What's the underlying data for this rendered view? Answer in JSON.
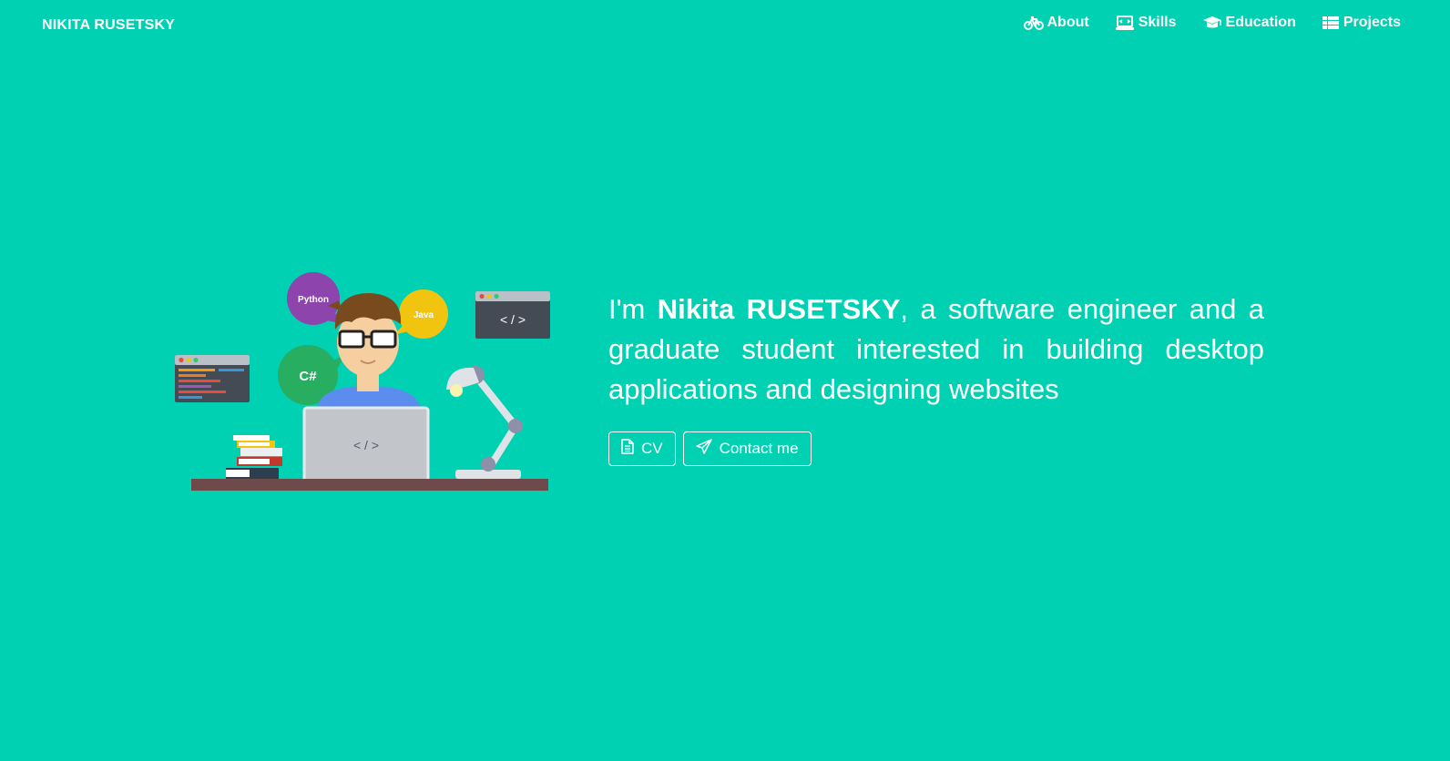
{
  "navbar": {
    "brand": "NIKITA RUSETSKY",
    "items": [
      {
        "label": "About",
        "icon": "bicycle-icon"
      },
      {
        "label": "Skills",
        "icon": "laptop-code-icon"
      },
      {
        "label": "Education",
        "icon": "graduation-cap-icon"
      },
      {
        "label": "Projects",
        "icon": "list-icon"
      }
    ]
  },
  "hero": {
    "line1_prefix": "I'm ",
    "name": "Nikita RUSETSKY",
    "line1_suffix": ", a software engineer and a",
    "line2": "graduate student interested in building desktop",
    "line3": "applications and designing websites",
    "buttons": {
      "cv_label": "CV",
      "cv_icon": "file-icon",
      "contact_label": "Contact me",
      "contact_icon": "paper-plane-icon"
    }
  },
  "illustration": {
    "bubbles": [
      "Python",
      "Java",
      "C#"
    ],
    "code_window_label": "< / >",
    "laptop_label": "< / >"
  },
  "colors": {
    "background": "#00d1b2",
    "text": "#ffffff",
    "python_bubble": "#8e44ad",
    "java_bubble": "#f1c40f",
    "csharp_bubble": "#27ae60"
  }
}
